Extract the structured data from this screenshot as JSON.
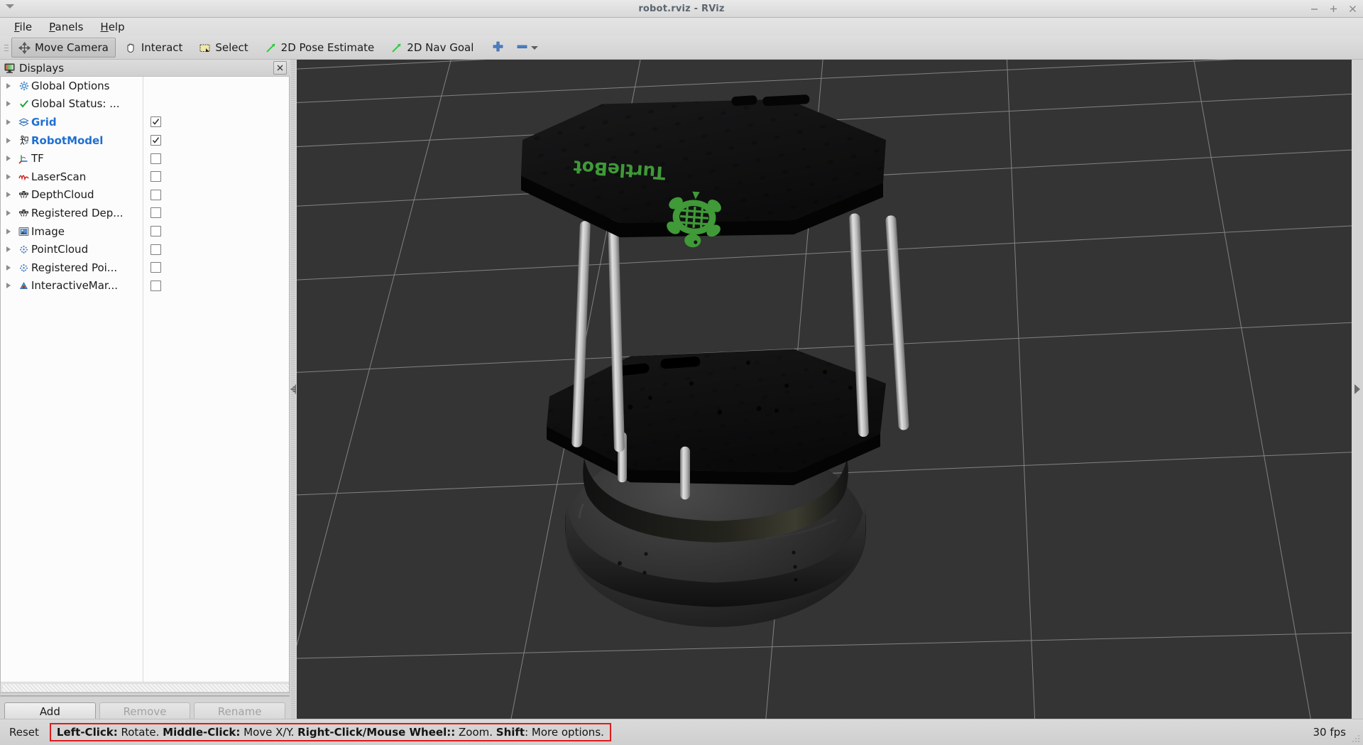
{
  "window": {
    "title": "robot.rviz - RViz",
    "controls": [
      {
        "name": "minimize",
        "glyph": "−"
      },
      {
        "name": "maximize",
        "glyph": "+"
      },
      {
        "name": "close",
        "glyph": "×"
      }
    ]
  },
  "menubar": {
    "items": [
      {
        "label": "File",
        "mnemonic": "F"
      },
      {
        "label": "Panels",
        "mnemonic": "P"
      },
      {
        "label": "Help",
        "mnemonic": "H"
      }
    ]
  },
  "toolbar": {
    "tools": [
      {
        "label": "Move Camera",
        "icon": "move-camera-icon",
        "checked": true
      },
      {
        "label": "Interact",
        "icon": "interact-hand-icon",
        "checked": false
      },
      {
        "label": "Select",
        "icon": "select-rect-icon",
        "checked": false
      },
      {
        "label": "2D Pose Estimate",
        "icon": "pose-arrow-icon",
        "checked": false
      },
      {
        "label": "2D Nav Goal",
        "icon": "nav-goal-arrow-icon",
        "checked": false
      }
    ],
    "add_tool_icon": "plus-icon",
    "remove_tool_icon": "minus-icon",
    "remove_tool_caret": "chevron-down-icon"
  },
  "displays_panel": {
    "title": "Displays",
    "icon": "displays-monitor-icon",
    "close_icon": "close-icon",
    "items": [
      {
        "label": "Global Options",
        "icon": "gear-icon",
        "highlight": false,
        "checkbox": null
      },
      {
        "label": "Global Status: ...",
        "icon": "checkmark-icon",
        "highlight": false,
        "checkbox": null
      },
      {
        "label": "Grid",
        "icon": "grid-icon",
        "highlight": true,
        "checkbox": true
      },
      {
        "label": "RobotModel",
        "icon": "robot-icon",
        "highlight": true,
        "checkbox": true
      },
      {
        "label": "TF",
        "icon": "tf-axes-icon",
        "highlight": false,
        "checkbox": false
      },
      {
        "label": "LaserScan",
        "icon": "laserscan-icon",
        "highlight": false,
        "checkbox": false
      },
      {
        "label": "DepthCloud",
        "icon": "depthcloud-icon",
        "highlight": false,
        "checkbox": false
      },
      {
        "label": "Registered Dep...",
        "icon": "depthcloud-icon",
        "highlight": false,
        "checkbox": false
      },
      {
        "label": "Image",
        "icon": "image-icon",
        "highlight": false,
        "checkbox": false
      },
      {
        "label": "PointCloud",
        "icon": "pointcloud-icon",
        "highlight": false,
        "checkbox": false
      },
      {
        "label": "Registered Poi...",
        "icon": "pointcloud-icon",
        "highlight": false,
        "checkbox": false
      },
      {
        "label": "InteractiveMar...",
        "icon": "interactive-marker-icon",
        "highlight": false,
        "checkbox": false
      }
    ],
    "buttons": [
      {
        "label": "Add",
        "enabled": true
      },
      {
        "label": "Remove",
        "enabled": false
      },
      {
        "label": "Rename",
        "enabled": false
      }
    ]
  },
  "viewport": {
    "background_color": "#343434",
    "grid_line_color": "#b4b4b4",
    "robot": {
      "name": "TurtleBot",
      "logo_text": "TurtleBot",
      "logo_color": "#3f9a37",
      "plate_color": "#121212",
      "standoff_color": "#c9c9c9",
      "base_color": "#2a2a2a",
      "led_color": "#d9a400"
    },
    "collapse_left_icon": "collapse-left-arrow-icon",
    "expand_right_icon": "expand-right-arrow-icon"
  },
  "statusbar": {
    "reset_label": "Reset",
    "hint_segments": [
      {
        "text": "Left-Click:",
        "bold": true
      },
      {
        "text": " Rotate. ",
        "bold": false
      },
      {
        "text": "Middle-Click:",
        "bold": true
      },
      {
        "text": " Move X/Y. ",
        "bold": false
      },
      {
        "text": "Right-Click/Mouse Wheel::",
        "bold": true
      },
      {
        "text": " Zoom. ",
        "bold": false
      },
      {
        "text": "Shift",
        "bold": true
      },
      {
        "text": ": More options.",
        "bold": false
      }
    ],
    "hint_border_color": "#e01b1b",
    "fps": "30 fps"
  }
}
